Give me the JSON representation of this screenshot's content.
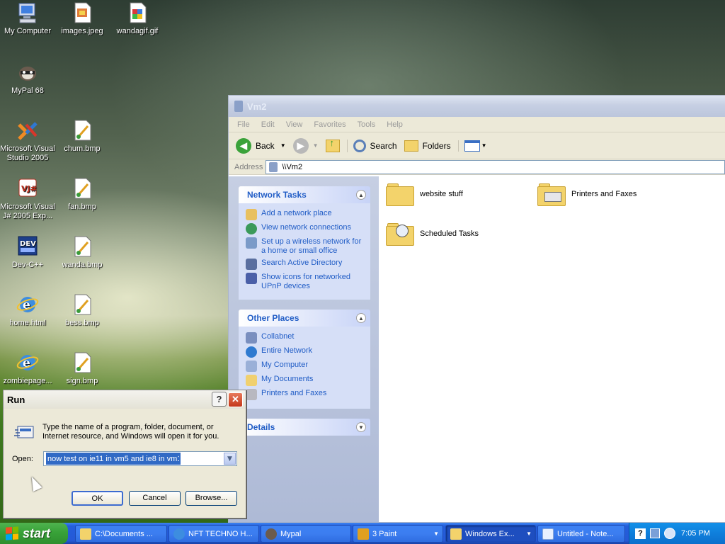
{
  "desktop": {
    "icons": [
      {
        "label": "My Computer"
      },
      {
        "label": "images.jpeg"
      },
      {
        "label": "wandagif.gif"
      },
      {
        "label": "MyPal 68"
      },
      {
        "label": "Microsoft Visual Studio 2005"
      },
      {
        "label": "chum.bmp"
      },
      {
        "label": "Microsoft Visual J# 2005 Exp..."
      },
      {
        "label": "fan.bmp"
      },
      {
        "label": "Dev-C++"
      },
      {
        "label": "wanda.bmp"
      },
      {
        "label": "home.html"
      },
      {
        "label": "bess.bmp"
      },
      {
        "label": "zombiepage..."
      },
      {
        "label": "sign.bmp"
      }
    ]
  },
  "explorer": {
    "title": "Vm2",
    "menu": [
      "File",
      "Edit",
      "View",
      "Favorites",
      "Tools",
      "Help"
    ],
    "toolbar": {
      "back": "Back",
      "search": "Search",
      "folders": "Folders"
    },
    "address_label": "Address",
    "address_value": "\\\\Vm2",
    "network_tasks": {
      "title": "Network Tasks",
      "items": [
        "Add a network place",
        "View network connections",
        "Set up a wireless network for a home or small office",
        "Search Active Directory",
        "Show icons for networked UPnP devices"
      ]
    },
    "other_places": {
      "title": "Other Places",
      "items": [
        "Collabnet",
        "Entire Network",
        "My Computer",
        "My Documents",
        "Printers and Faxes"
      ]
    },
    "details": {
      "title": "Details"
    },
    "content": [
      "website stuff",
      "Printers and Faxes",
      "Scheduled Tasks"
    ]
  },
  "run": {
    "title": "Run",
    "description": "Type the name of a program, folder, document, or Internet resource, and Windows will open it for you.",
    "open_label": "Open:",
    "open_value": "now test on ie11 in vm5 and ie8 in vm1",
    "ok": "OK",
    "cancel": "Cancel",
    "browse": "Browse..."
  },
  "taskbar": {
    "start": "start",
    "tasks": [
      {
        "label": "C:\\Documents ..."
      },
      {
        "label": "NFT TECHNO H..."
      },
      {
        "label": "Mypal"
      },
      {
        "label": "3 Paint"
      },
      {
        "label": "Windows Ex..."
      },
      {
        "label": "Untitled - Note..."
      }
    ],
    "clock": "7:05 PM"
  },
  "colors": {
    "xp_blue": "#245edb",
    "start_green": "#38a238",
    "task_link": "#215dc6",
    "selection": "#316ac5"
  }
}
